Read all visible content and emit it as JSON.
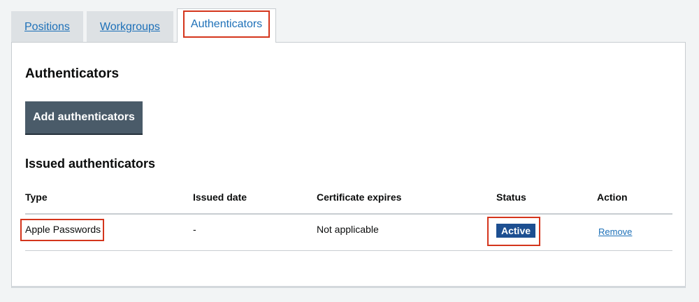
{
  "tabs": [
    {
      "label": "Positions"
    },
    {
      "label": "Workgroups"
    },
    {
      "label": "Authenticators"
    }
  ],
  "panel": {
    "title": "Authenticators",
    "add_button_label": "Add authenticators",
    "section_title": "Issued authenticators"
  },
  "table": {
    "headers": {
      "type": "Type",
      "issued_date": "Issued date",
      "certificate_expires": "Certificate expires",
      "status": "Status",
      "action": "Action"
    },
    "rows": [
      {
        "type": "Apple Passwords",
        "issued_date": "-",
        "certificate_expires": "Not applicable",
        "status": "Active",
        "action": "Remove"
      }
    ]
  },
  "colors": {
    "link": "#1d70b8",
    "highlight": "#d4351c",
    "button": "#4a5b69",
    "status_active": "#1d4f91"
  }
}
